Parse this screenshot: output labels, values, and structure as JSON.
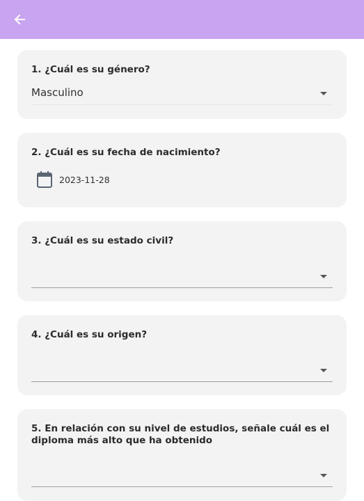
{
  "appbar": {
    "back_icon": "arrow-left-icon",
    "color": "#c9a4f0"
  },
  "questions": [
    {
      "title": "1. ¿Cuál es su género?",
      "value": "Masculino"
    },
    {
      "title": "2. ¿Cuál es su fecha de nacimiento?",
      "icon": "calendar-icon",
      "value": "2023-11-28"
    },
    {
      "title": "3. ¿Cuál es su estado civil?",
      "value": ""
    },
    {
      "title": "4. ¿Cuál es su origen?",
      "value": ""
    },
    {
      "title": "5. En relación con su nivel de estudios, señale cuál es el diploma más alto que ha obtenido",
      "value": ""
    }
  ]
}
